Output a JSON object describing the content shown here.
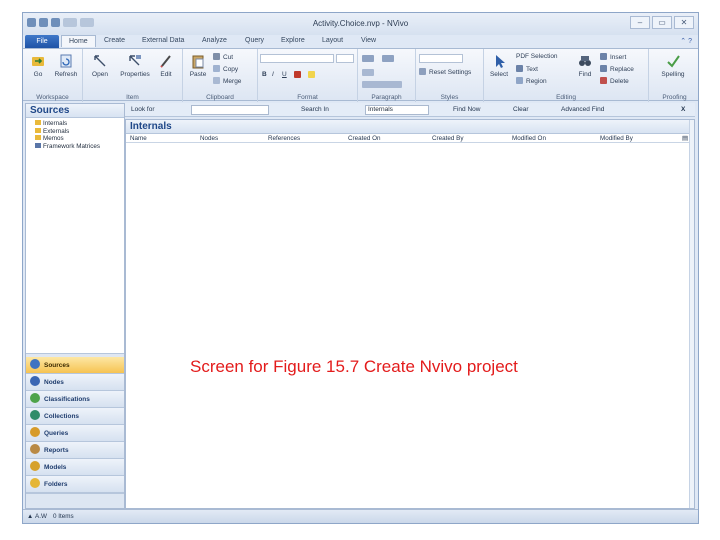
{
  "window": {
    "title": "Activity.Choice.nvp - NVivo",
    "controls": [
      "–",
      "▭",
      "✕"
    ]
  },
  "quick_access": [
    "save-icon",
    "undo-icon",
    "redo-icon"
  ],
  "ribbon_tabs": [
    {
      "label": "File"
    },
    {
      "label": "Home"
    },
    {
      "label": "Create"
    },
    {
      "label": "External Data"
    },
    {
      "label": "Analyze"
    },
    {
      "label": "Query"
    },
    {
      "label": "Explore"
    },
    {
      "label": "Layout"
    },
    {
      "label": "View"
    }
  ],
  "ribbon_help": "⌃ ?",
  "ribbon": {
    "workspace": {
      "label": "Workspace",
      "go": "Go",
      "refresh": "Refresh"
    },
    "item": {
      "label": "Item",
      "open": "Open",
      "properties": "Properties",
      "edit": "Edit"
    },
    "clipboard": {
      "label": "Clipboard",
      "paste": "Paste",
      "cut": "Cut",
      "copy": "Copy",
      "merge": "Merge"
    },
    "format": {
      "label": "Format",
      "bold": "B",
      "italic": "I",
      "underline": "U"
    },
    "paragraph": {
      "label": "Paragraph"
    },
    "styles": {
      "label": "Styles",
      "reset": "Reset Settings"
    },
    "editing": {
      "label": "Editing",
      "select": "Select",
      "pdf_selection": "PDF Selection",
      "text": "Text",
      "region": "Region",
      "find": "Find",
      "insert": "Insert",
      "replace": "Replace",
      "delete": "Delete"
    },
    "proofing": {
      "label": "Proofing",
      "spelling": "Spelling"
    }
  },
  "findbar": {
    "look_for": "Look for",
    "search_in": "Search In",
    "search_in_value": "Internals",
    "find_now": "Find Now",
    "clear": "Clear",
    "advanced_find": "Advanced Find",
    "close": "X"
  },
  "nav": {
    "title": "Sources",
    "tree": [
      {
        "label": "Internals",
        "icon": "folder-icon",
        "color": "#e9b93a"
      },
      {
        "label": "Externals",
        "icon": "folder-icon",
        "color": "#e9b93a"
      },
      {
        "label": "Memos",
        "icon": "folder-icon",
        "color": "#e9b93a"
      },
      {
        "label": "Framework Matrices",
        "icon": "matrix-icon",
        "color": "#5a76a8"
      }
    ],
    "buttons": [
      {
        "label": "Sources",
        "icon": "sources-icon",
        "color": "#3f73c2",
        "active": true
      },
      {
        "label": "Nodes",
        "icon": "nodes-icon",
        "color": "#3a66b4",
        "active": false
      },
      {
        "label": "Classifications",
        "icon": "classifications-icon",
        "color": "#4ea34a",
        "active": false
      },
      {
        "label": "Collections",
        "icon": "collections-icon",
        "color": "#2f8c6a",
        "active": false
      },
      {
        "label": "Queries",
        "icon": "queries-icon",
        "color": "#d79b2a",
        "active": false
      },
      {
        "label": "Reports",
        "icon": "reports-icon",
        "color": "#b98a45",
        "active": false
      },
      {
        "label": "Models",
        "icon": "models-icon",
        "color": "#d6a12c",
        "active": false
      },
      {
        "label": "Folders",
        "icon": "folders-icon",
        "color": "#e5b636",
        "active": false
      }
    ]
  },
  "content": {
    "title": "Internals",
    "columns": [
      "Name",
      "Nodes",
      "References",
      "Created On",
      "Created By",
      "Modified On",
      "Modified By"
    ]
  },
  "caption": "Screen for Figure 15.7  Create Nvivo project",
  "status": {
    "user": "A.W",
    "items": "0 Items"
  }
}
